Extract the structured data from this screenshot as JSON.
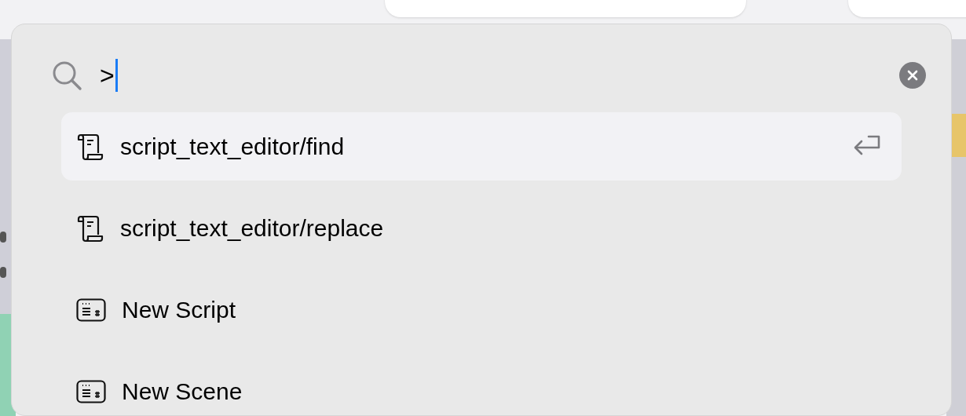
{
  "search": {
    "value": ">"
  },
  "results": [
    {
      "kind": "script",
      "label": "script_text_editor/find",
      "selected": true
    },
    {
      "kind": "script",
      "label": "script_text_editor/replace",
      "selected": false
    },
    {
      "kind": "command",
      "label": "New Script",
      "selected": false
    },
    {
      "kind": "command",
      "label": "New Scene",
      "selected": false
    }
  ]
}
